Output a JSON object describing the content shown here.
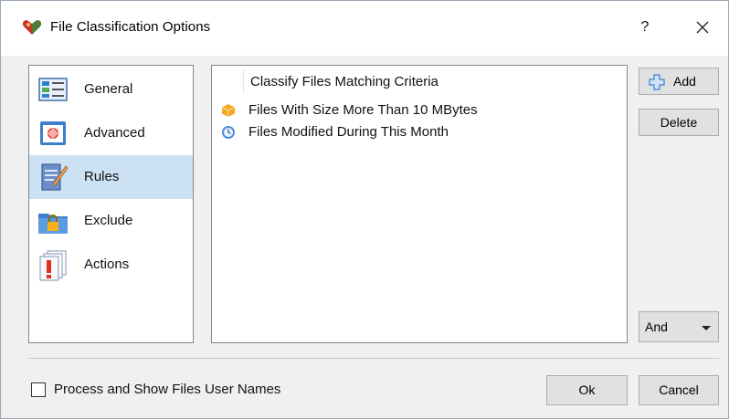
{
  "window": {
    "title": "File Classification Options",
    "help_label": "?",
    "close_label": "✕"
  },
  "sidebar": {
    "items": [
      {
        "label": "General",
        "icon": "general-icon",
        "selected": false
      },
      {
        "label": "Advanced",
        "icon": "advanced-icon",
        "selected": false
      },
      {
        "label": "Rules",
        "icon": "rules-icon",
        "selected": true
      },
      {
        "label": "Exclude",
        "icon": "exclude-lock-icon",
        "selected": false
      },
      {
        "label": "Actions",
        "icon": "actions-icon",
        "selected": false
      }
    ]
  },
  "criteria": {
    "header": "Classify Files Matching Criteria",
    "items": [
      {
        "text": "Files With Size More Than 10 MBytes",
        "icon": "size-box-icon"
      },
      {
        "text": "Files Modified During This Month",
        "icon": "clock-icon"
      }
    ]
  },
  "buttons": {
    "add": "Add",
    "delete": "Delete",
    "ok": "Ok",
    "cancel": "Cancel"
  },
  "operator": {
    "value": "And"
  },
  "options": {
    "process_user_names_label": "Process and Show Files User Names",
    "process_user_names_checked": false
  },
  "colors": {
    "selection": "#cce1f3",
    "window_bg": "#f0f0f0"
  }
}
